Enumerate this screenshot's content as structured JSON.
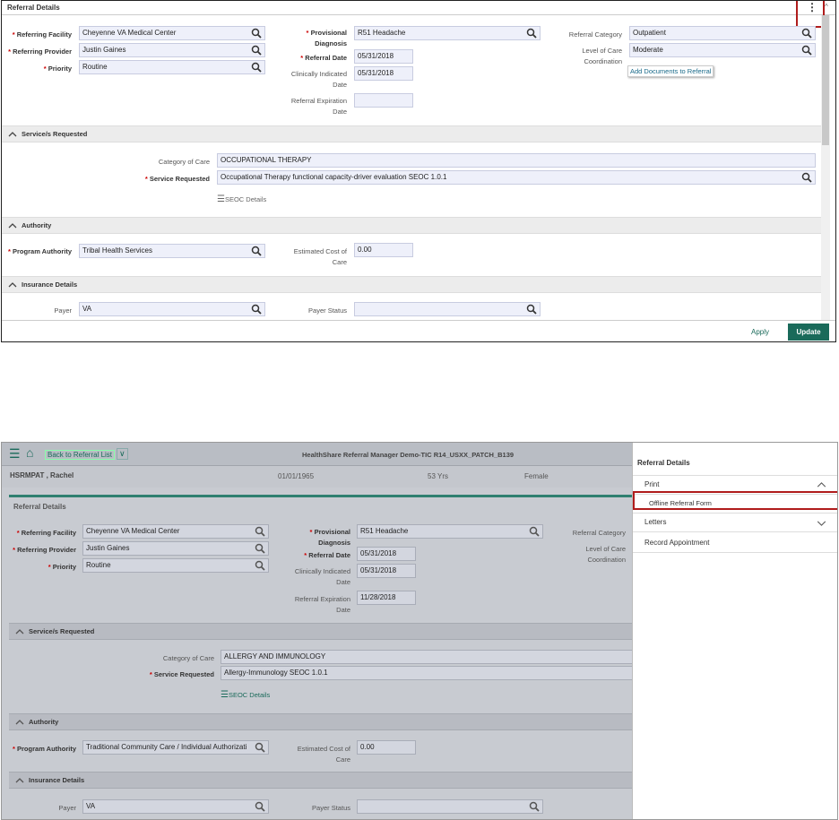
{
  "top": {
    "header": "Referral Details",
    "referring_facility": {
      "label": "Referring Facility",
      "value": "Cheyenne VA Medical Center"
    },
    "referring_provider": {
      "label": "Referring Provider",
      "value": "Justin Gaines"
    },
    "priority": {
      "label": "Priority",
      "value": "Routine"
    },
    "provisional_diagnosis": {
      "label": "Provisional Diagnosis",
      "value": "R51 Headache"
    },
    "referral_date": {
      "label": "Referral Date",
      "value": "05/31/2018"
    },
    "clinically_indicated": {
      "label": "Clinically Indicated Date",
      "value": "05/31/2018"
    },
    "expiration": {
      "label": "Referral Expiration Date",
      "value": ""
    },
    "referral_category": {
      "label": "Referral Category",
      "value": "Outpatient"
    },
    "level_of_care": {
      "label": "Level of Care Coordination",
      "value": "Moderate"
    },
    "add_documents": "Add Documents to Referral",
    "services_header": "Service/s Requested",
    "category_of_care": {
      "label": "Category of Care",
      "value": "OCCUPATIONAL THERAPY"
    },
    "service_requested": {
      "label": "Service Requested",
      "value": "Occupational Therapy functional capacity-driver evaluation SEOC 1.0.1"
    },
    "seoc_details": "SEOC Details",
    "authority_header": "Authority",
    "program_authority": {
      "label": "Program Authority",
      "value": "Tribal Health Services"
    },
    "estimated_cost": {
      "label": "Estimated Cost of Care",
      "value": "0.00"
    },
    "insurance_header": "Insurance Details",
    "payer": {
      "label": "Payer",
      "value": "VA"
    },
    "payer_status": {
      "label": "Payer Status",
      "value": ""
    },
    "apply": "Apply",
    "update": "Update"
  },
  "bottom": {
    "back_label": "Back to Referral List",
    "app_title": "HealthShare Referral Manager Demo-TIC R14_USXX_PATCH_B139",
    "patient_name": "HSRMPAT , Rachel",
    "dob": "01/01/1965",
    "age": "53 Yrs",
    "sex": "Female",
    "header": "Referral Details",
    "referring_facility": {
      "label": "Referring Facility",
      "value": "Cheyenne VA Medical Center"
    },
    "referring_provider": {
      "label": "Referring Provider",
      "value": "Justin Gaines"
    },
    "priority": {
      "label": "Priority",
      "value": "Routine"
    },
    "provisional_diagnosis": {
      "label": "Provisional Diagnosis",
      "value": "R51 Headache"
    },
    "referral_date": {
      "label": "Referral Date",
      "value": "05/31/2018"
    },
    "clinically_indicated": {
      "label": "Clinically Indicated Date",
      "value": "05/31/2018"
    },
    "expiration": {
      "label": "Referral Expiration Date",
      "value": "11/28/2018"
    },
    "referral_category": {
      "label": "Referral Category"
    },
    "level_of_care": {
      "label": "Level of Care Coordination"
    },
    "services_header": "Service/s Requested",
    "category_of_care": {
      "label": "Category of Care",
      "value": "ALLERGY AND IMMUNOLOGY"
    },
    "service_requested": {
      "label": "Service Requested",
      "value": "Allergy-Immunology SEOC 1.0.1"
    },
    "seoc_details": "SEOC Details",
    "authority_header": "Authority",
    "program_authority": {
      "label": "Program Authority",
      "value": "Traditional Community Care / Individual Authorizati"
    },
    "estimated_cost": {
      "label": "Estimated Cost of Care",
      "value": "0.00"
    },
    "insurance_header": "Insurance Details",
    "payer": {
      "label": "Payer",
      "value": "VA"
    },
    "payer_status": {
      "label": "Payer Status",
      "value": ""
    }
  },
  "side_menu": {
    "title": "Referral Details",
    "print": "Print",
    "offline_form": "Offline Referral Form",
    "letters": "Letters",
    "record_appointment": "Record Appointment"
  },
  "colors": {
    "accent_green": "#1a6a5a",
    "highlight_red": "#b01c1c",
    "field_bg": "#eef0fa"
  }
}
